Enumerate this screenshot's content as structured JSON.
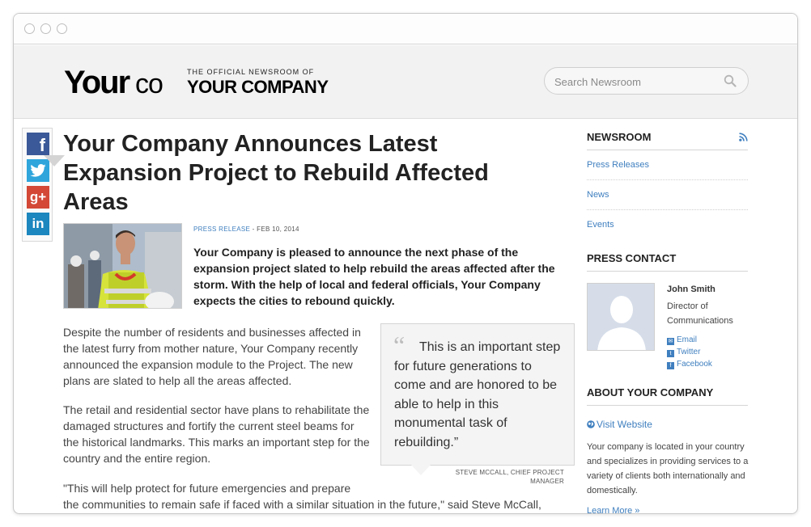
{
  "header": {
    "logo_your": "Your",
    "logo_co": "co",
    "tagline_small": "THE OFFICIAL NEWSROOM OF",
    "tagline_big": "YOUR COMPANY",
    "search_placeholder": "Search Newsroom"
  },
  "social": {
    "facebook_glyph": "f",
    "googleplus_glyph": "g+",
    "linkedin_glyph": "in"
  },
  "article": {
    "title": "Your Company Announces Latest Expansion Project to Rebuild Affected Areas",
    "category": "PRESS RELEASE",
    "date": " - FEB 10, 2014",
    "lead": "Your Company is pleased to announce the next phase of the expansion project slated to help rebuild the areas affected after the storm. With the help of local and federal officials, Your Company expects the cities to rebound quickly.",
    "para1": "Despite the number of residents and businesses affected in the latest furry from mother nature, Your Company recently announced the expansion module to the Project. The new plans are slated to help all the areas affected.",
    "para2": "The retail and residential sector have plans to rehabilitate the damaged structures and fortify the current steel beams for the historical landmarks. This marks an important step for the country and the entire region.",
    "para3_line1": "\"This will help protect for future emergencies and prepare",
    "para3_line2": "the communities to remain safe if faced with a similar situation in the future,\" said Steve McCall,"
  },
  "quote": {
    "text": "This is an important step for future generations to come and are honored to be able to help in this monumental task of rebuilding.”",
    "attribution_line1": "STEVE MCCALL, CHIEF PROJECT",
    "attribution_line2": "MANAGER"
  },
  "sidebar": {
    "newsroom_heading": "NEWSROOM",
    "links": [
      "Press Releases",
      "News",
      "Events"
    ],
    "contact_heading": "PRESS CONTACT",
    "contact_name": "John Smith",
    "contact_role": "Director of Communications",
    "contact_links": [
      "Email",
      "Twitter",
      "Facebook"
    ],
    "about_heading": "ABOUT YOUR COMPANY",
    "visit_label": "Visit Website",
    "about_text": "Your company is located in your country and specializes in providing services to a variety of clients both internationally and domestically.",
    "learn_more": "Learn More »"
  },
  "colors": {
    "link_blue": "#3f7fbf",
    "facebook": "#3b5998",
    "twitter": "#2fa5dc",
    "googleplus": "#d34836",
    "linkedin": "#1c86be"
  }
}
